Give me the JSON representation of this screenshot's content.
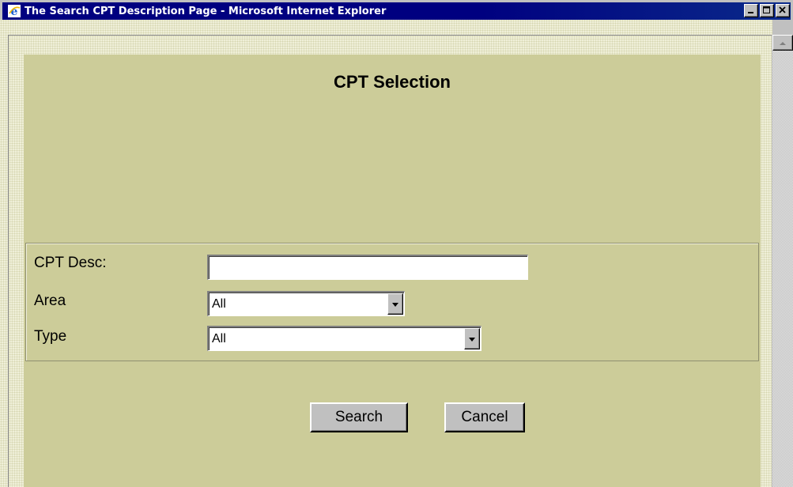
{
  "window": {
    "title": "The Search CPT Description Page - Microsoft Internet Explorer",
    "controls": [
      "minimize",
      "maximize",
      "close"
    ]
  },
  "page": {
    "title": "CPT Selection"
  },
  "form": {
    "cpt_desc": {
      "label": "CPT Desc:",
      "value": ""
    },
    "area": {
      "label": "Area",
      "selected": "All"
    },
    "type": {
      "label": "Type",
      "selected": "All"
    }
  },
  "buttons": {
    "search": "Search",
    "cancel": "Cancel"
  },
  "colors": {
    "panel": "#cccc99",
    "titlebar": "#000080",
    "chrome": "#c0c0c0"
  },
  "icons": {
    "app": "ie-logo-icon",
    "minimize": "minimize-icon",
    "maximize": "maximize-icon",
    "close": "close-icon",
    "scroll_up": "arrow-up-icon",
    "dropdown": "chevron-down-icon"
  }
}
